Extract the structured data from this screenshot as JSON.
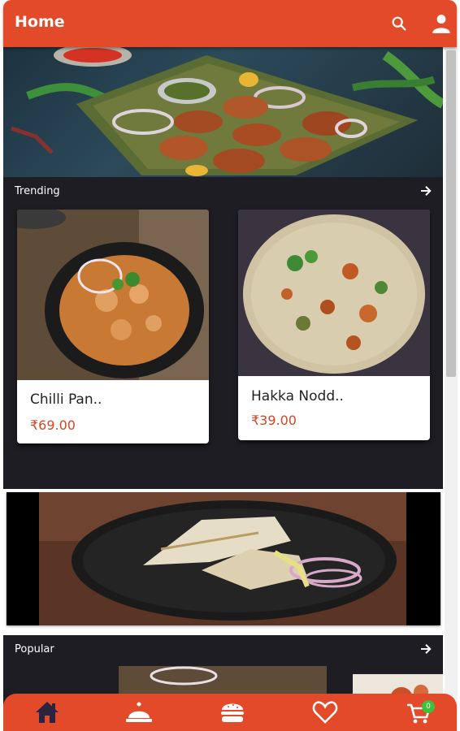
{
  "app": {
    "title": "Home"
  },
  "header_icons": [
    "search-icon",
    "account-icon"
  ],
  "sections": {
    "trending": {
      "title": "Trending"
    },
    "popular": {
      "title": "Popular"
    }
  },
  "trending_items": [
    {
      "name": "Chilli Pan..",
      "price": "₹69.00"
    },
    {
      "name": "Hakka Nodd..",
      "price": "₹39.00"
    }
  ],
  "bottom_nav": {
    "items": [
      "home-icon",
      "menu-cloche-icon",
      "burger-icon",
      "favorite-heart-icon",
      "cart-icon"
    ],
    "cart_count": "0"
  },
  "colors": {
    "primary": "#e24a2a",
    "dark_section": "#1f1d24",
    "price": "#d0472a",
    "badge": "#3cc23c"
  }
}
